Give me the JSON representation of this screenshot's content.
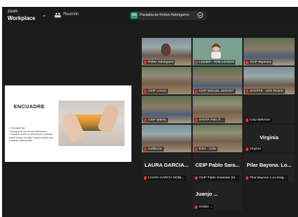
{
  "app": {
    "logo_line1": "zoom",
    "logo_line2": "Workplace",
    "meeting_label": "Reunión",
    "share_indicator": "Pantalla de Rober Adorigamo",
    "share_badge": "RA"
  },
  "slide": {
    "title": "ENCUADRE",
    "body": "• Encuadre fijo\n• Desayunar con la representación\n• Guardar numeros elementos comunes fuerte la bay montaje Cuando deber que nosotros representas\n",
    "photo_desc": "hands-frame-sunset"
  },
  "participants": [
    {
      "name": "Rober Adorigamo",
      "type": "video-man"
    },
    {
      "name": "Lourdes - Hola Lectores",
      "type": "video-woman"
    },
    {
      "name": "CEIP Bujaraza",
      "type": "video-classroom"
    },
    {
      "name": "CEIP Lozam",
      "type": "video-classroom"
    },
    {
      "name": "CEIP MIGUEL SERVET",
      "type": "video-classroom"
    },
    {
      "name": "SANTFE - Inés Ricarte",
      "type": "video-classroom"
    },
    {
      "name": "CEIP MIRAL",
      "type": "video-classroom"
    },
    {
      "name": "SANTA ANA 4º...",
      "type": "video-classroom"
    },
    {
      "name": "Ceip MIRANA",
      "type": "video-dark"
    },
    {
      "name": "Guillermo",
      "type": "video-classroom"
    },
    {
      "name": "ESO - Lidia",
      "type": "video-classroom"
    },
    {
      "name": "Virginia",
      "type": "name-only",
      "display_name": "Virginia"
    },
    {
      "name": "LAURA GARCIA NOBL...",
      "type": "name-only",
      "display_name": "LAURA GARCIA..."
    },
    {
      "name": "CEIP Pablo Sarasate (M...",
      "type": "name-only",
      "display_name": "CEIP Pablo Sara..."
    },
    {
      "name": "Pilar Bayona. Los imag...",
      "type": "name-only",
      "display_name": "Pilar Bayona. Lo..."
    },
    {
      "name": "Juanjo ...",
      "type": "name-only",
      "display_name": "Juanjo ..."
    }
  ]
}
